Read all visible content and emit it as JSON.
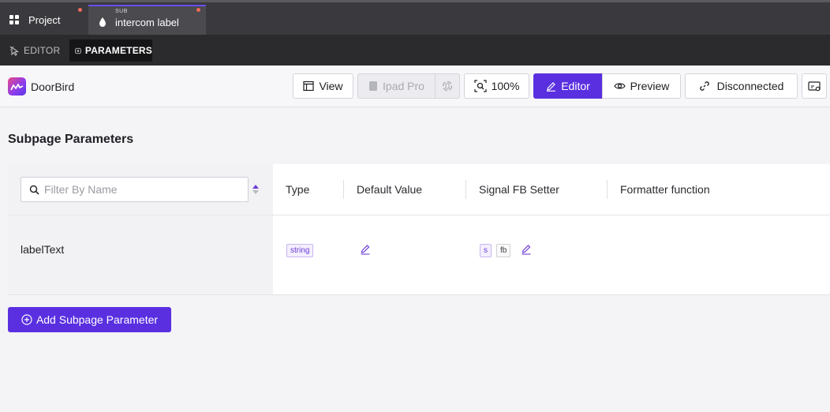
{
  "tabs": {
    "project": {
      "label": "Project"
    },
    "subpage": {
      "tag": "SUB",
      "label": "intercom label"
    }
  },
  "modes": {
    "editor": "EDITOR",
    "parameters": "PARAMETERS"
  },
  "toolbar": {
    "brand": "DoorBird",
    "view": "View",
    "device": "Ipad Pro",
    "zoom": "100%",
    "editor": "Editor",
    "preview": "Preview",
    "connection": "Disconnected"
  },
  "section_title": "Subpage Parameters",
  "filter": {
    "placeholder": "Filter By Name",
    "value": ""
  },
  "columns": [
    "Type",
    "Default Value",
    "Signal FB Setter",
    "Formatter function"
  ],
  "rows": [
    {
      "name": "labelText",
      "type": "string",
      "signal_badges": [
        "s",
        "fb"
      ]
    }
  ],
  "add_button": "Add Subpage Parameter",
  "colors": {
    "accent": "#5a2fe0",
    "unsaved_dot": "#f06a5a"
  }
}
